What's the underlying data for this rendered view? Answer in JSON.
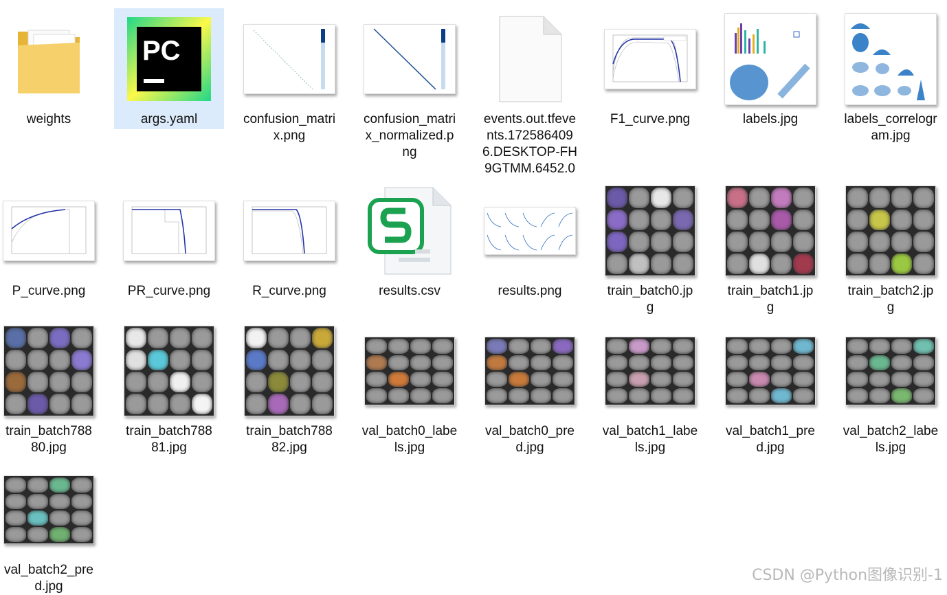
{
  "files": [
    {
      "name": "weights",
      "type": "folder"
    },
    {
      "name": "args.yaml",
      "type": "pycharm",
      "selected": true
    },
    {
      "name": "confusion_matrix.png",
      "type": "png"
    },
    {
      "name": "confusion_matrix_normalized.png",
      "type": "png"
    },
    {
      "name": "events.out.tfevents.1725864096.DESKTOP-FH9GTMM.6452.0",
      "type": "file"
    },
    {
      "name": "F1_curve.png",
      "type": "png"
    },
    {
      "name": "labels.jpg",
      "type": "jpg"
    },
    {
      "name": "labels_correlogram.jpg",
      "type": "jpg"
    },
    {
      "name": "P_curve.png",
      "type": "png"
    },
    {
      "name": "PR_curve.png",
      "type": "png"
    },
    {
      "name": "R_curve.png",
      "type": "png"
    },
    {
      "name": "results.csv",
      "type": "csv"
    },
    {
      "name": "results.png",
      "type": "png"
    },
    {
      "name": "train_batch0.jpg",
      "type": "jpg"
    },
    {
      "name": "train_batch1.jpg",
      "type": "jpg"
    },
    {
      "name": "train_batch2.jpg",
      "type": "jpg"
    },
    {
      "name": "train_batch78880.jpg",
      "type": "jpg"
    },
    {
      "name": "train_batch78881.jpg",
      "type": "jpg"
    },
    {
      "name": "train_batch78882.jpg",
      "type": "jpg"
    },
    {
      "name": "val_batch0_labels.jpg",
      "type": "jpg"
    },
    {
      "name": "val_batch0_pred.jpg",
      "type": "jpg"
    },
    {
      "name": "val_batch1_labels.jpg",
      "type": "jpg"
    },
    {
      "name": "val_batch1_pred.jpg",
      "type": "jpg"
    },
    {
      "name": "val_batch2_labels.jpg",
      "type": "jpg"
    },
    {
      "name": "val_batch2_pred.jpg",
      "type": "jpg"
    }
  ],
  "labels": {
    "f0": "weights",
    "f1": "args.yaml",
    "f2": "confusion_matri\nx.png",
    "f3": "confusion_matri\nx_normalized.p\nng",
    "f4": "events.out.tfeve\nnts.172586409\n6.DESKTOP-FH\n9GTMM.6452.0",
    "f5": "F1_curve.png",
    "f6": "labels.jpg",
    "f7": "labels_correlogr\nam.jpg",
    "f8": "P_curve.png",
    "f9": "PR_curve.png",
    "f10": "R_curve.png",
    "f11": "results.csv",
    "f12": "results.png",
    "f13": "train_batch0.jp\ng",
    "f14": "train_batch1.jp\ng",
    "f15": "train_batch2.jp\ng",
    "f16": "train_batch788\n80.jpg",
    "f17": "train_batch788\n81.jpg",
    "f18": "train_batch788\n82.jpg",
    "f19": "val_batch0_labe\nls.jpg",
    "f20": "val_batch0_pre\nd.jpg",
    "f21": "val_batch1_labe\nls.jpg",
    "f22": "val_batch1_pre\nd.jpg",
    "f23": "val_batch2_labe\nls.jpg",
    "f24": "val_batch2_pre\nd.jpg"
  },
  "pycharm_text": "PC",
  "watermark": "CSDN @Python图像识别-1",
  "colors": {
    "selection": "#dcebfb",
    "folder": "#f5c542",
    "pycharm_green": "#21d789",
    "pycharm_yellow": "#fcf84a",
    "csv_green": "#1aa251"
  }
}
